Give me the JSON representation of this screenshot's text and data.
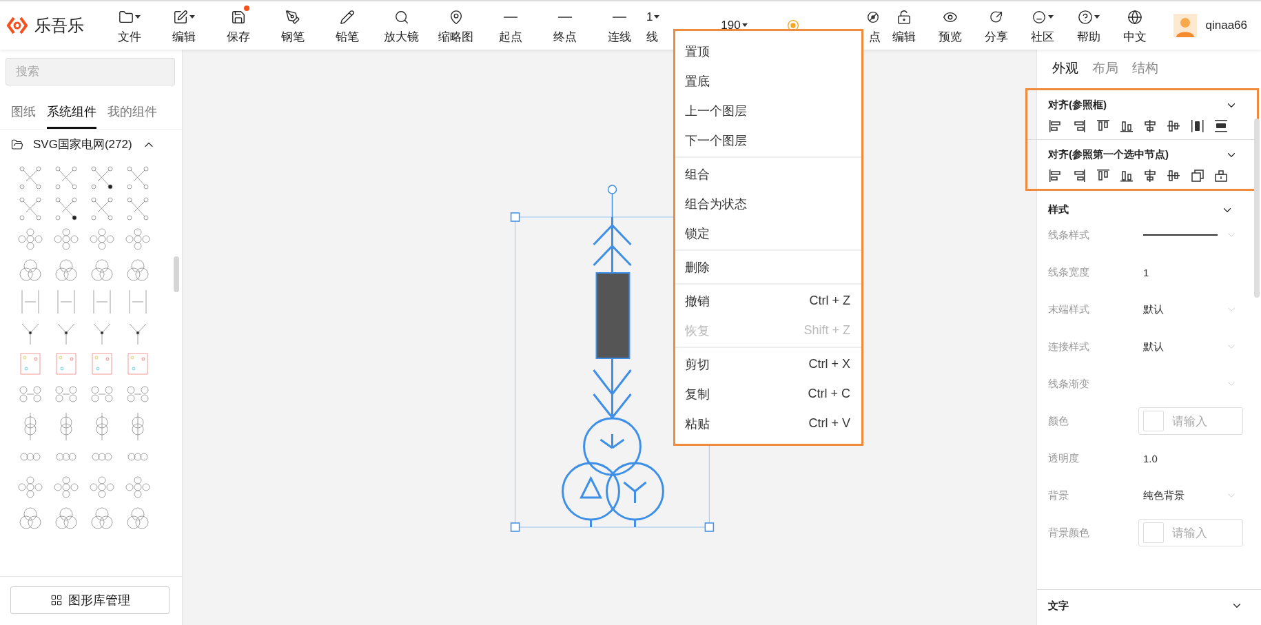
{
  "app": {
    "name": "乐吾乐"
  },
  "toolbar": {
    "items": [
      {
        "kind": "button",
        "label": "文件",
        "caret": true,
        "badge": false
      },
      {
        "kind": "button",
        "label": "编辑",
        "caret": true,
        "badge": false
      },
      {
        "kind": "button",
        "label": "保存",
        "caret": false,
        "badge": true
      },
      {
        "kind": "button",
        "label": "钢笔",
        "caret": false,
        "badge": false
      },
      {
        "kind": "button",
        "label": "铅笔",
        "caret": false,
        "badge": false
      },
      {
        "kind": "button",
        "label": "放大镜",
        "caret": false,
        "badge": false
      },
      {
        "kind": "button",
        "label": "缩略图",
        "caret": false,
        "badge": false
      },
      {
        "kind": "button",
        "label": "起点",
        "caret": false,
        "badge": false
      },
      {
        "kind": "button",
        "label": "终点",
        "caret": false,
        "badge": false
      },
      {
        "kind": "button",
        "label": "连线",
        "caret": false,
        "badge": false
      },
      {
        "kind": "value",
        "value": "1",
        "label": "线",
        "caret": true,
        "badge": false
      },
      {
        "kind": "value",
        "value": "190",
        "caret": true,
        "badge": false
      },
      {
        "kind": "button",
        "caret": false,
        "badge": false
      },
      {
        "kind": "button",
        "label": "点",
        "caret": false,
        "badge": false
      },
      {
        "kind": "button",
        "label": "编辑",
        "caret": false,
        "badge": false
      },
      {
        "kind": "button",
        "label": "预览",
        "caret": false,
        "badge": false
      },
      {
        "kind": "button",
        "label": "分享",
        "caret": false,
        "badge": false
      },
      {
        "kind": "button",
        "label": "社区",
        "caret": true,
        "badge": false
      },
      {
        "kind": "button",
        "label": "帮助",
        "caret": true,
        "badge": false
      },
      {
        "kind": "button",
        "label": "中文",
        "caret": false,
        "badge": false
      }
    ],
    "user": {
      "name": "qinaa66"
    }
  },
  "library": {
    "search": {
      "placeholder": "搜索"
    },
    "tabs": [
      {
        "label": "图纸",
        "selected": false
      },
      {
        "label": "系统组件",
        "selected": true
      },
      {
        "label": "我的组件",
        "selected": false
      }
    ],
    "folder": {
      "label": "SVG国家电网(272)",
      "expanded": true
    },
    "manage_button": "图形库管理"
  },
  "context_menu": {
    "groups": [
      [
        {
          "label": "置顶",
          "disabled": false
        },
        {
          "label": "置底",
          "disabled": false
        },
        {
          "label": "上一个图层",
          "disabled": false
        },
        {
          "label": "下一个图层",
          "disabled": false
        }
      ],
      [
        {
          "label": "组合",
          "disabled": false
        },
        {
          "label": "组合为状态",
          "disabled": false
        },
        {
          "label": "锁定",
          "disabled": false
        }
      ],
      [
        {
          "label": "删除",
          "disabled": false
        }
      ],
      [
        {
          "label": "撤销",
          "shortcut": "Ctrl + Z",
          "disabled": false
        },
        {
          "label": "恢复",
          "shortcut": "Shift + Z",
          "disabled": true
        }
      ],
      [
        {
          "label": "剪切",
          "shortcut": "Ctrl + X",
          "disabled": false
        },
        {
          "label": "复制",
          "shortcut": "Ctrl + C",
          "disabled": false
        },
        {
          "label": "粘贴",
          "shortcut": "Ctrl + V",
          "disabled": false
        }
      ]
    ]
  },
  "properties": {
    "tabs": [
      {
        "label": "外观",
        "selected": true
      },
      {
        "label": "布局",
        "selected": false
      },
      {
        "label": "结构",
        "selected": false
      }
    ],
    "align_sections": [
      {
        "title": "对齐(参照框)"
      },
      {
        "title": "对齐(参照第一个选中节点)"
      }
    ],
    "style_section": {
      "title": "样式",
      "rows": [
        {
          "kind": "line",
          "label": "线条样式"
        },
        {
          "kind": "text",
          "label": "线条宽度",
          "value": "1"
        },
        {
          "kind": "select",
          "label": "末端样式",
          "value": "默认"
        },
        {
          "kind": "select",
          "label": "连接样式",
          "value": "默认"
        },
        {
          "kind": "select",
          "label": "线条渐变"
        },
        {
          "kind": "color",
          "label": "颜色",
          "placeholder": "请输入"
        },
        {
          "kind": "text",
          "label": "透明度",
          "value": "1.0"
        },
        {
          "kind": "select",
          "label": "背景",
          "value": "纯色背景"
        },
        {
          "kind": "color",
          "label": "背景颜色",
          "placeholder": "请输入"
        }
      ]
    },
    "text_section": {
      "title": "文字"
    }
  }
}
